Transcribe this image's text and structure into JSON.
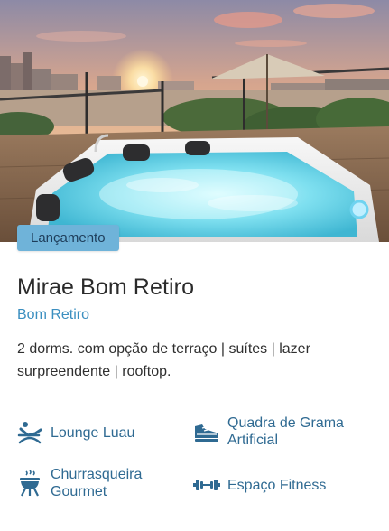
{
  "colors": {
    "badge_bg": "#6fb3d9",
    "accent_blue": "#3b8fc0",
    "amenity_blue": "#2f6a92",
    "icon_blue": "#2f6a92"
  },
  "card": {
    "badge": "Lançamento",
    "title": "Mirae Bom Retiro",
    "neighborhood": "Bom Retiro",
    "description": "2 dorms. com opção de terraço | suítes | lazer surpreendente | rooftop."
  },
  "amenities": [
    {
      "label": "Lounge Luau",
      "icon": "lounge-chair-icon"
    },
    {
      "label": "Quadra de Grama Artificial",
      "icon": "sneaker-icon"
    },
    {
      "label": "Churrasqueira Gourmet",
      "icon": "grill-icon"
    },
    {
      "label": "Espaço Fitness",
      "icon": "dumbbell-icon"
    }
  ]
}
